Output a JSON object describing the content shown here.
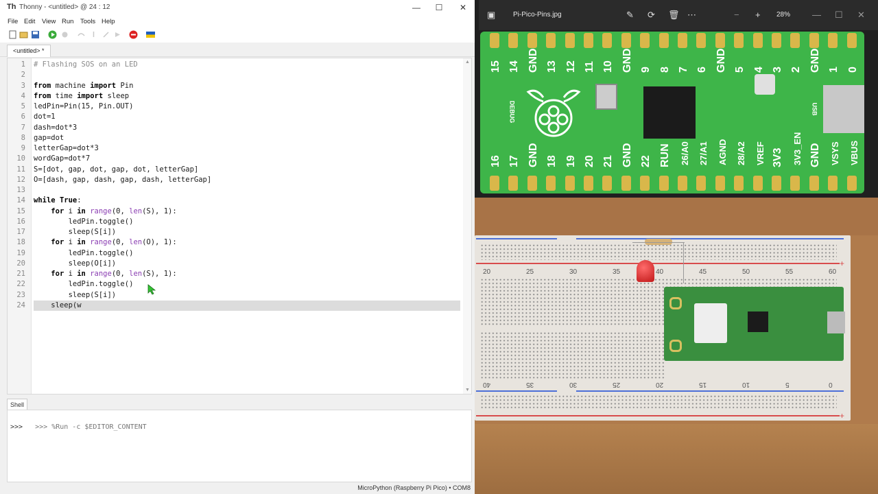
{
  "thonny": {
    "title": "Thonny  -  <untitled>  @  24 : 12",
    "menu": [
      "File",
      "Edit",
      "View",
      "Run",
      "Tools",
      "Help"
    ],
    "tab_label": "<untitled> *",
    "code_lines": [
      "# Flashing SOS on an LED",
      "",
      "from machine import Pin",
      "from time import sleep",
      "ledPin=Pin(15, Pin.OUT)",
      "dot=1",
      "dash=dot*3",
      "gap=dot",
      "letterGap=dot*3",
      "wordGap=dot*7",
      "S=[dot, gap, dot, gap, dot, letterGap]",
      "O=[dash, gap, dash, gap, dash, letterGap]",
      "",
      "while True:",
      "    for i in range(0, len(S), 1):",
      "        ledPin.toggle()",
      "        sleep(S[i])",
      "    for i in range(0, len(O), 1):",
      "        ledPin.toggle()",
      "        sleep(O[i])",
      "    for i in range(0, len(S), 1):",
      "        ledPin.toggle()",
      "        sleep(S[i])",
      "    sleep(w"
    ],
    "shell_label": "Shell",
    "shell_lines": [
      ">>> %Run -c $EDITOR_CONTENT",
      ">>>"
    ],
    "status": "MicroPython (Raspberry Pi Pico)  •  COM8"
  },
  "viewer": {
    "filename": "Pi-Pico-Pins.jpg",
    "zoom": "28%",
    "top_pins": [
      "15",
      "14",
      "GND",
      "13",
      "12",
      "11",
      "10",
      "GND",
      "9",
      "8",
      "7",
      "6",
      "GND",
      "5",
      "4",
      "3",
      "2",
      "GND",
      "1",
      "0"
    ],
    "bottom_pins": [
      "16",
      "17",
      "GND",
      "18",
      "19",
      "20",
      "21",
      "GND",
      "22",
      "RUN",
      "26/A0",
      "27/A1",
      "AGND",
      "28/A2",
      "VREF",
      "3V3",
      "3V3_EN",
      "GND",
      "VSYS",
      "VBUS"
    ],
    "board_labels": {
      "debug": "DEBUG",
      "usb": "USB"
    }
  },
  "breadboard": {
    "top_numbers": [
      "20",
      "25",
      "30",
      "35",
      "40",
      "45",
      "50",
      "55",
      "60"
    ],
    "bottom_numbers": [
      "40",
      "35",
      "30",
      "25",
      "20",
      "15",
      "10",
      "5",
      "0"
    ]
  }
}
